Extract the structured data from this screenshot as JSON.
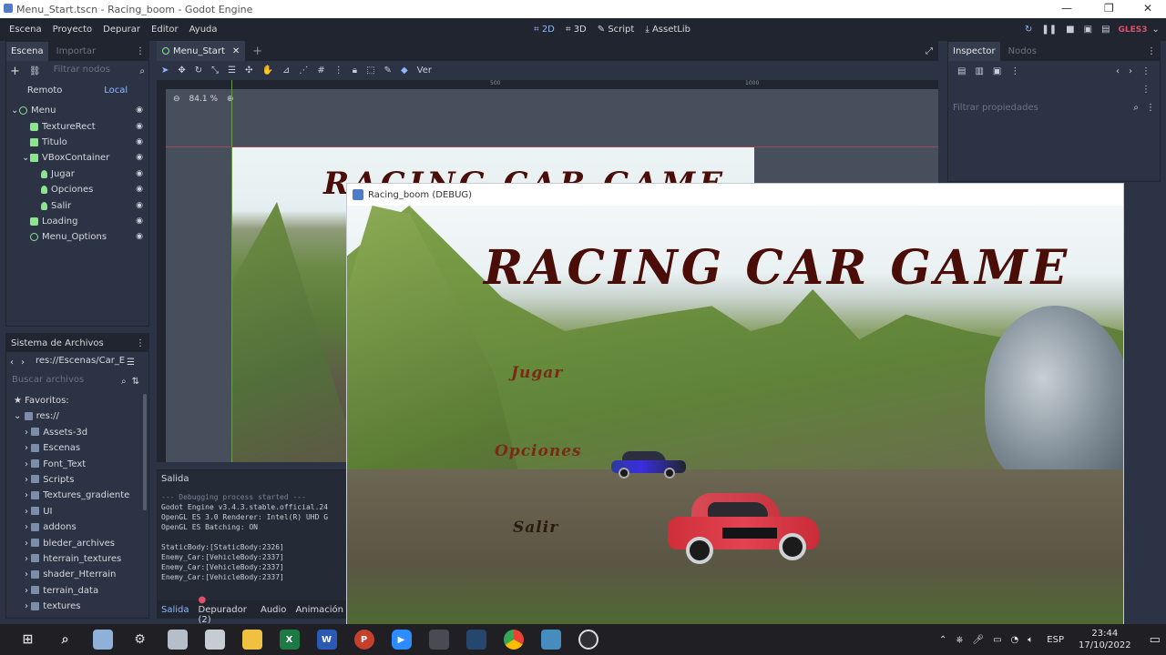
{
  "window": {
    "title": "Menu_Start.tscn - Racing_boom - Godot Engine"
  },
  "menu": [
    "Escena",
    "Proyecto",
    "Depurar",
    "Editor",
    "Ayuda"
  ],
  "modes": [
    "2D",
    "3D",
    "Script",
    "AssetLib"
  ],
  "renderer": "GLES3",
  "scene_dock": {
    "tabs": [
      "Escena",
      "Importar"
    ],
    "filter_placeholder": "Filtrar nodos",
    "remote_label": "Remoto",
    "local_label": "Local",
    "nodes": [
      {
        "name": "Menu",
        "icon": "node-icon",
        "depth": 0
      },
      {
        "name": "TextureRect",
        "icon": "texturerect-icon",
        "depth": 1
      },
      {
        "name": "Titulo",
        "icon": "label-icon",
        "depth": 1
      },
      {
        "name": "VBoxContainer",
        "icon": "container-icon",
        "depth": 1
      },
      {
        "name": "Jugar",
        "icon": "button-icon",
        "depth": 2
      },
      {
        "name": "Opciones",
        "icon": "button-icon",
        "depth": 2
      },
      {
        "name": "Salir",
        "icon": "button-icon",
        "depth": 2
      },
      {
        "name": "Loading",
        "icon": "texturerect-icon",
        "depth": 1
      },
      {
        "name": "Menu_Options",
        "icon": "node-icon",
        "depth": 1
      }
    ]
  },
  "filesystem": {
    "title": "Sistema de Archivos",
    "path": "res://Escenas/Car_Ene",
    "search_placeholder": "Buscar archivos",
    "favorites": "Favoritos:",
    "root": "res://",
    "folders": [
      "Assets-3d",
      "Escenas",
      "Font_Text",
      "Scripts",
      "Textures_gradiente",
      "UI",
      "addons",
      "bleder_archives",
      "hterrain_textures",
      "shader_Hterrain",
      "terrain_data",
      "textures"
    ]
  },
  "editor": {
    "tab": "Menu_Start",
    "zoom": "84.1 %",
    "view_menu": "Ver",
    "ruler_marks": [
      "500",
      "1000"
    ]
  },
  "output": {
    "title": "Salida",
    "lines": [
      "--- Debugging process started ---",
      "Godot Engine v3.4.3.stable.official.24",
      "OpenGL ES 3.0 Renderer: Intel(R) UHD G",
      "OpenGL ES Batching: ON",
      "",
      "StaticBody:[StaticBody:2326]",
      "Enemy_Car:[VehicleBody:2337]",
      "Enemy_Car:[VehicleBody:2337]",
      "Enemy_Car:[VehicleBody:2337]"
    ],
    "bottom_tabs": [
      "Salida",
      "Depurador (2)",
      "Audio",
      "Animación"
    ]
  },
  "inspector": {
    "tabs": [
      "Inspector",
      "Nodos"
    ],
    "filter_placeholder": "Filtrar propiedades"
  },
  "game_window": {
    "title": "Racing_boom (DEBUG)",
    "game_title": "RACING CAR GAME",
    "buttons": [
      "Jugar",
      "Opciones",
      "Salir"
    ]
  },
  "taskbar": {
    "lang": "ESP",
    "time": "23:44",
    "date": "17/10/2022"
  },
  "colors": {
    "accent": "#8fb8ff",
    "renderer": "#e0506a",
    "title_game": "#4a0d08"
  }
}
